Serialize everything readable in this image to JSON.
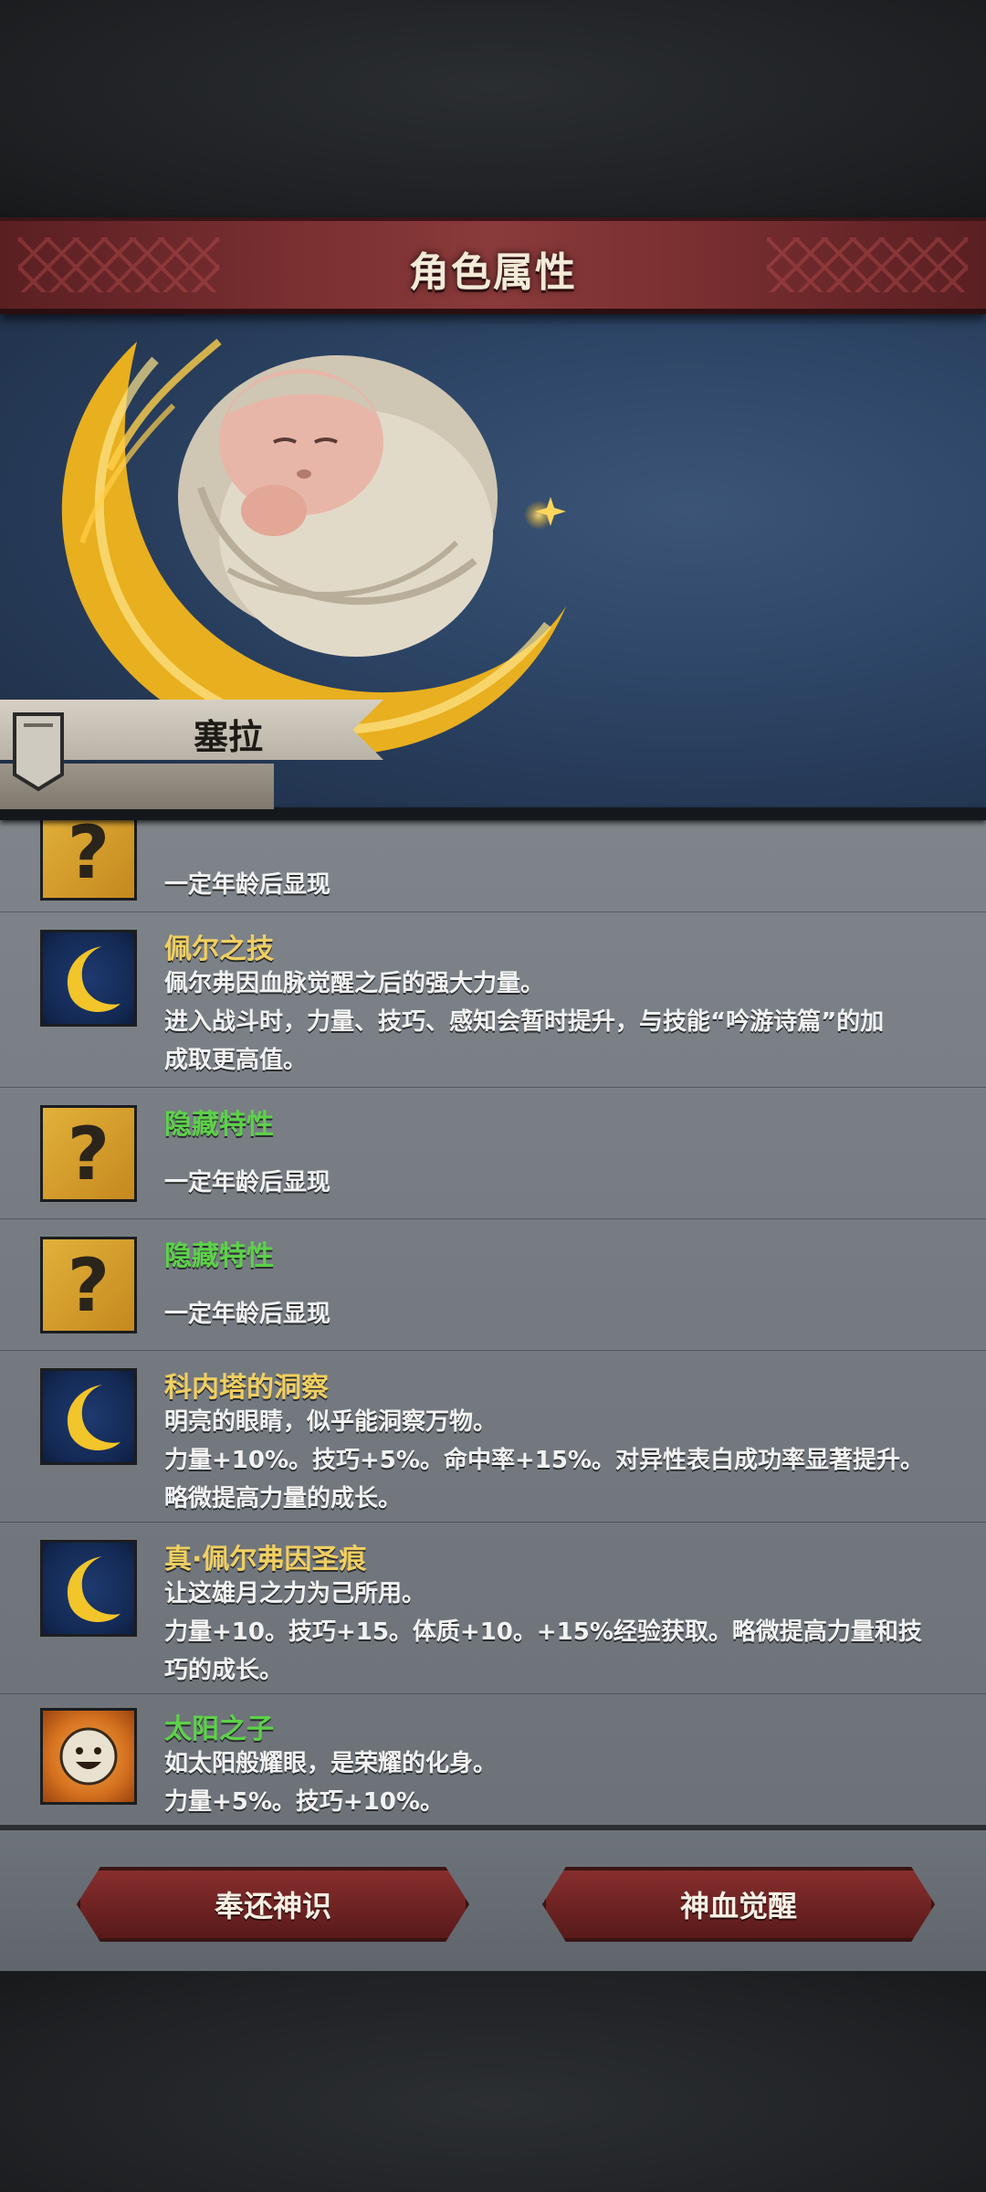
{
  "header": {
    "title": "角色属性"
  },
  "character": {
    "name": "塞拉"
  },
  "traits": [
    {
      "icon": "question-icon",
      "title": "",
      "title_color": "gold",
      "lines": [
        "一定年龄后显现"
      ]
    },
    {
      "icon": "moon-icon",
      "title": "佩尔之技",
      "title_color": "gold",
      "lines": [
        "佩尔弗因血脉觉醒之后的强大力量。",
        "进入战斗时，力量、技巧、感知会暂时提升，与技能“吟游诗篇”的加",
        "成取更高值。"
      ]
    },
    {
      "icon": "question-icon",
      "title": "隐藏特性",
      "title_color": "green",
      "lines": [
        "",
        "一定年龄后显现"
      ]
    },
    {
      "icon": "question-icon",
      "title": "隐藏特性",
      "title_color": "green",
      "lines": [
        "",
        "一定年龄后显现"
      ]
    },
    {
      "icon": "moon-icon",
      "title": "科内塔的洞察",
      "title_color": "gold",
      "lines": [
        "明亮的眼睛，似乎能洞察万物。",
        "力量+10%。技巧+5%。命中率+15%。对异性表白成功率显著提升。",
        "略微提高力量的成长。"
      ]
    },
    {
      "icon": "moon-icon",
      "title": "真·佩尔弗因圣痕",
      "title_color": "gold",
      "lines": [
        "让这雄月之力为己所用。",
        "力量+10。技巧+15。体质+10。+15%经验获取。略微提高力量和技",
        "巧的成长。"
      ]
    },
    {
      "icon": "sun-face-icon",
      "title": "太阳之子",
      "title_color": "green",
      "lines": [
        "如太阳般耀眼，是荣耀的化身。",
        "力量+5%。技巧+10%。"
      ]
    }
  ],
  "actions": {
    "left_label": "奉还神识",
    "right_label": "神血觉醒"
  }
}
